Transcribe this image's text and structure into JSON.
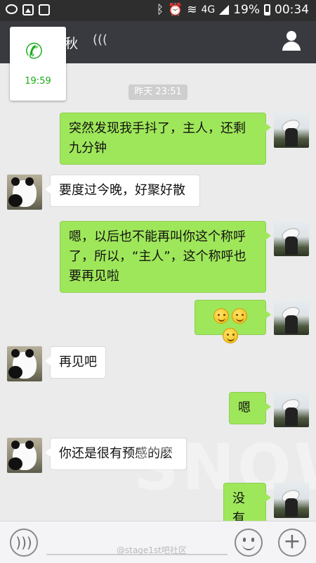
{
  "status_bar": {
    "network": "4G",
    "battery": "19%",
    "time": "00:34"
  },
  "header": {
    "title_partial": "秋"
  },
  "call_card": {
    "duration": "19:59"
  },
  "timestamp": "昨天 23:51",
  "messages": [
    {
      "side": "me",
      "text": "突然发现我手抖了，主人，还剩九分钟"
    },
    {
      "side": "them",
      "text": "要度过今晚，好聚好散"
    },
    {
      "side": "me",
      "text": "嗯，以后也不能再叫你这个称呼了，所以，“主人”，这个称呼也要再见啦"
    },
    {
      "side": "me",
      "text": "",
      "emoji": [
        "smile",
        "smile",
        "smile"
      ]
    },
    {
      "side": "them",
      "text": "再见吧"
    },
    {
      "side": "me",
      "text": "嗯"
    },
    {
      "side": "them",
      "text": "你还是很有预感的麽"
    },
    {
      "side": "me",
      "text": "没有"
    }
  ],
  "watermark": "SNOW",
  "input_bar": {
    "voice_icon": "voice-icon",
    "emoji_icon": "emoji-icon",
    "plus_icon": "plus-icon"
  },
  "credit": "@stage1st吧社区",
  "colors": {
    "my_bubble": "#9fe75a",
    "their_bubble": "#ffffff",
    "header": "#393a3f",
    "accent": "#1aad19"
  }
}
